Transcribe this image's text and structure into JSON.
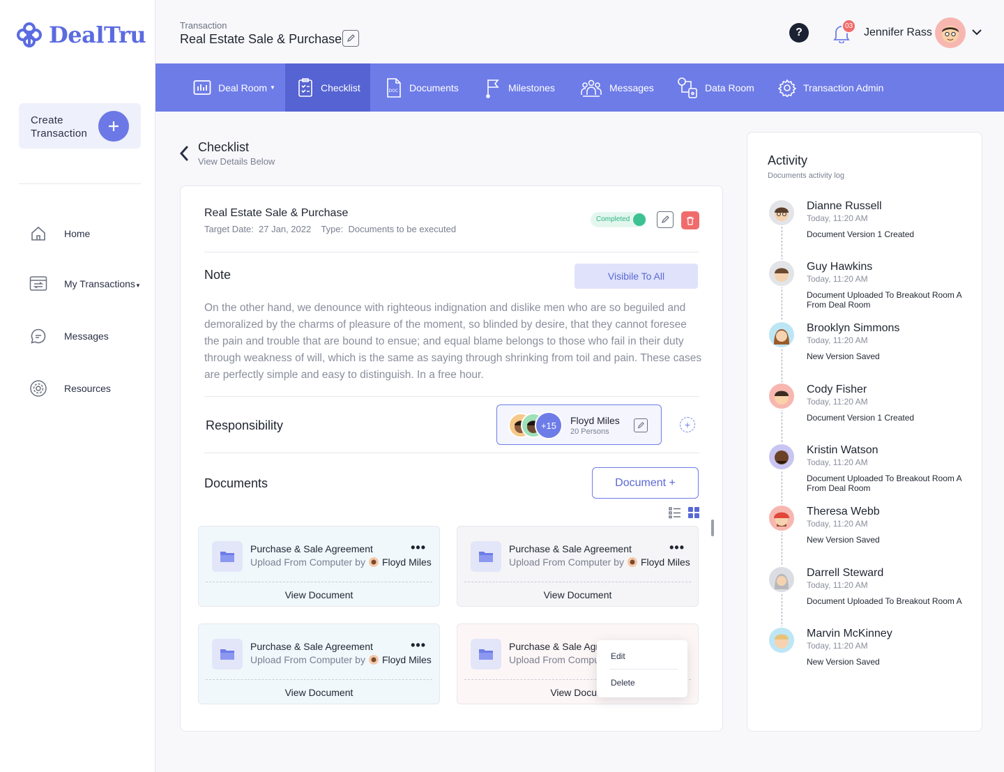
{
  "brand": {
    "name": "DealTru",
    "color": "#5b6be0"
  },
  "sidebar": {
    "create_label": "Create Transaction",
    "items": [
      {
        "label": "Home",
        "icon": "home-icon"
      },
      {
        "label": "My Transactions",
        "icon": "transactions-icon"
      },
      {
        "label": "Messages",
        "icon": "chat-icon"
      },
      {
        "label": "Resources",
        "icon": "gear-icon"
      }
    ]
  },
  "header": {
    "breadcrumb": "Transaction",
    "title": "Real Estate Sale & Purchase",
    "notification_count": "03",
    "user_name": "Jennifer Rass"
  },
  "tabs": [
    {
      "label": "Deal Room",
      "icon": "chart-icon",
      "has_dropdown": true
    },
    {
      "label": "Checklist",
      "icon": "checklist-icon",
      "active": true
    },
    {
      "label": "Documents",
      "icon": "doc-icon"
    },
    {
      "label": "Milestones",
      "icon": "flag-icon"
    },
    {
      "label": "Messages",
      "icon": "team-icon"
    },
    {
      "label": "Data Room",
      "icon": "data-room-icon"
    },
    {
      "label": "Transaction Admin",
      "icon": "gear-icon"
    }
  ],
  "page": {
    "title": "Checklist",
    "subtitle": "View Details Below"
  },
  "item": {
    "title": "Real Estate Sale & Purchase",
    "meta": "Target Date:  27 Jan, 2022    Type:  Documents to be executed",
    "status": "Completed",
    "status_color": "#3cc193"
  },
  "note": {
    "title": "Note",
    "visibility_label": "Visibile To All",
    "text": "On the other hand, we denounce with righteous indignation and dislike men who are so beguiled and demoralized by the charms of pleasure of the moment, so blinded by desire, that they cannot foresee the pain and trouble that are bound to ensue; and equal blame belongs to those who fail in their duty through weakness of will, which is the same as saying through shrinking from toil and pain. These cases are perfectly simple and easy to distinguish. In a free hour."
  },
  "responsibility": {
    "title": "Responsibility",
    "extra_count": "+15",
    "name": "Floyd Miles",
    "sub": "20 Persons"
  },
  "documents": {
    "title": "Documents",
    "add_label": "Document +",
    "cards": [
      {
        "title": "Purchase & Sale Agreement",
        "by": "Upload From Computer by",
        "owner": "Floyd Miles",
        "action": "View Document"
      },
      {
        "title": "Purchase & Sale Agreement",
        "by": "Upload From Computer by",
        "owner": "Floyd Miles",
        "action": "View Document"
      },
      {
        "title": "Purchase & Sale Agreement",
        "by": "Upload From Computer by",
        "owner": "Floyd Miles",
        "action": "View Document"
      },
      {
        "title": "Purchase & Sale Agr",
        "by": "Upload From Comput",
        "owner": "",
        "action": "View Docum"
      }
    ],
    "menu": {
      "edit": "Edit",
      "delete": "Delete"
    }
  },
  "activity": {
    "title": "Activity",
    "subtitle": "Documents activity log",
    "items": [
      {
        "name": "Dianne Russell",
        "time": "Today, 11:20 AM",
        "desc": "Document Version 1 Created"
      },
      {
        "name": "Guy Hawkins",
        "time": "Today, 11:20 AM",
        "desc": "Document Uploaded To Breakout Room A From Deal Room"
      },
      {
        "name": "Brooklyn Simmons",
        "time": "Today, 11:20 AM",
        "desc": "New Version Saved"
      },
      {
        "name": "Cody Fisher",
        "time": "Today, 11:20 AM",
        "desc": "Document Version 1 Created"
      },
      {
        "name": "Kristin Watson",
        "time": "Today, 11:20 AM",
        "desc": "Document Uploaded To Breakout Room A From Deal Room"
      },
      {
        "name": "Theresa Webb",
        "time": "Today, 11:20 AM",
        "desc": "New Version Saved"
      },
      {
        "name": "Darrell Steward",
        "time": "Today, 11:20 AM",
        "desc": "Document Uploaded To Breakout Room A"
      },
      {
        "name": "Marvin McKinney",
        "time": "Today, 11:20 AM",
        "desc": "New Version Saved"
      }
    ]
  }
}
